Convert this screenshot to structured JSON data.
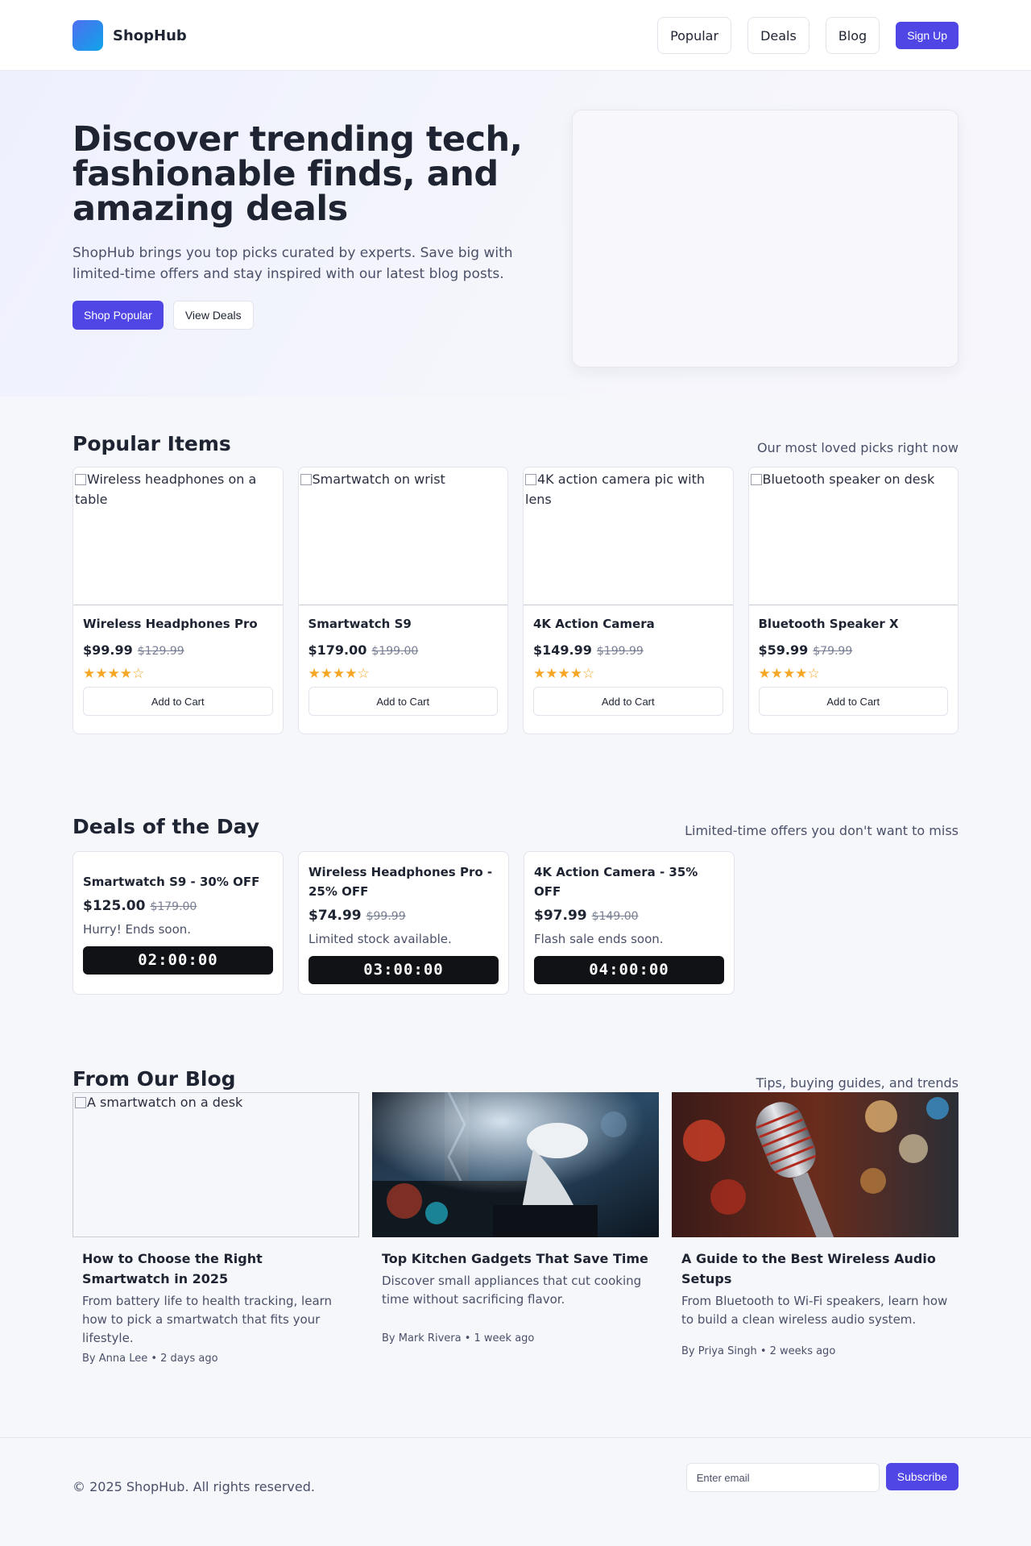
{
  "header": {
    "brand": "ShopHub",
    "nav": [
      "Popular",
      "Deals",
      "Blog"
    ],
    "signup": "Sign Up"
  },
  "hero": {
    "title": "Discover trending tech, fashionable finds, and amazing deals",
    "subtitle": "ShopHub brings you top picks curated by experts. Save big with limited-time offers and stay inspired with our latest blog posts.",
    "primary_cta": "Shop Popular",
    "secondary_cta": "View Deals"
  },
  "popular": {
    "title": "Popular Items",
    "aside": "Our most loved picks right now",
    "items": [
      {
        "alt": "Wireless headphones on a table",
        "name": "Wireless Headphones Pro",
        "price": "$99.99",
        "old_price": "$129.99",
        "stars": "★★★★☆",
        "cart": "Add to Cart"
      },
      {
        "alt": "Smartwatch on wrist",
        "name": "Smartwatch S9",
        "price": "$179.00",
        "old_price": "$199.00",
        "stars": "★★★★☆",
        "cart": "Add to Cart"
      },
      {
        "alt": "4K action camera pic with lens",
        "name": "4K Action Camera",
        "price": "$149.99",
        "old_price": "$199.99",
        "stars": "★★★★☆",
        "cart": "Add to Cart"
      },
      {
        "alt": "Bluetooth speaker on desk",
        "name": "Bluetooth Speaker X",
        "price": "$59.99",
        "old_price": "$79.99",
        "stars": "★★★★☆",
        "cart": "Add to Cart"
      }
    ]
  },
  "deals": {
    "title": "Deals of the Day",
    "aside": "Limited-time offers you don't want to miss",
    "items": [
      {
        "name": "Smartwatch S9 - 30% OFF",
        "price": "$125.00",
        "old_price": "$179.00",
        "note": "Hurry! Ends soon.",
        "timer": "02:00:00"
      },
      {
        "name": "Wireless Headphones Pro - 25% OFF",
        "price": "$74.99",
        "old_price": "$99.99",
        "note": "Limited stock available.",
        "timer": "03:00:00"
      },
      {
        "name": "4K Action Camera - 35% OFF",
        "price": "$97.99",
        "old_price": "$149.00",
        "note": "Flash sale ends soon.",
        "timer": "04:00:00"
      }
    ]
  },
  "blog": {
    "title": "From Our Blog",
    "aside": "Tips, buying guides, and trends",
    "posts": [
      {
        "alt": "A smartwatch on a desk",
        "title": "How to Choose the Right Smartwatch in 2025",
        "desc": "From battery life to health tracking, learn how to pick a smartwatch that fits your lifestyle.",
        "meta": "By Anna Lee • 2 days ago"
      },
      {
        "alt": "",
        "title": "Top Kitchen Gadgets That Save Time",
        "desc": "Discover small appliances that cut cooking time without sacrificing flavor.",
        "meta": "By Mark Rivera • 1 week ago"
      },
      {
        "alt": "",
        "title": "A Guide to the Best Wireless Audio Setups",
        "desc": "From Bluetooth to Wi-Fi speakers, learn how to build a clean wireless audio system.",
        "meta": "By Priya Singh • 2 weeks ago"
      }
    ]
  },
  "footer": {
    "copyright": "© 2025 ShopHub. All rights reserved.",
    "email_placeholder": "Enter email",
    "subscribe": "Subscribe"
  },
  "colors": {
    "accent": "#4f46e5",
    "star": "#f5a623",
    "timer_bg": "#111216"
  }
}
